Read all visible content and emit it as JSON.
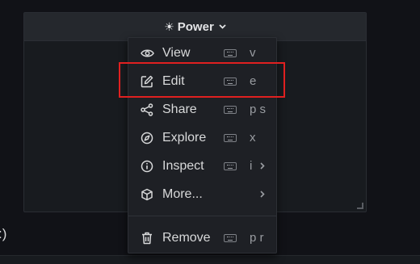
{
  "panel": {
    "title": "Power",
    "title_icon": "sun-icon",
    "menu_icon": "chevron-down-icon"
  },
  "background_fragment": ":)",
  "menu": {
    "items": [
      {
        "label": "View",
        "shortcut": "v",
        "icon": "eye-icon",
        "has_submenu": false
      },
      {
        "label": "Edit",
        "shortcut": "e",
        "icon": "edit-icon",
        "has_submenu": false
      },
      {
        "label": "Share",
        "shortcut": "p s",
        "icon": "share-icon",
        "has_submenu": false
      },
      {
        "label": "Explore",
        "shortcut": "x",
        "icon": "compass-icon",
        "has_submenu": false
      },
      {
        "label": "Inspect",
        "shortcut": "i",
        "icon": "info-icon",
        "has_submenu": true
      },
      {
        "label": "More...",
        "shortcut": "",
        "icon": "cube-icon",
        "has_submenu": true
      },
      {
        "label": "Remove",
        "shortcut": "p r",
        "icon": "trash-icon",
        "has_submenu": false
      }
    ],
    "highlighted_item": "Edit"
  },
  "colors": {
    "background": "#111217",
    "panel": "#181b1f",
    "panel_header": "#25282d",
    "menu": "#1e2025",
    "text": "#d8d9da",
    "highlight_box": "#e02020"
  }
}
